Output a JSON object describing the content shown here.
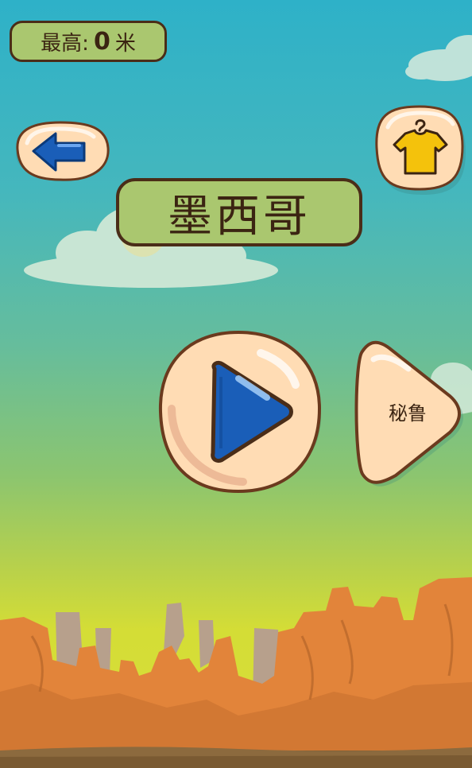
{
  "score": {
    "label": "最高:",
    "value": "0",
    "unit": "米"
  },
  "level": {
    "title": "墨西哥"
  },
  "next_level": {
    "label": "秘鲁"
  },
  "icons": {
    "back": "arrow-left-icon",
    "shop": "shirt-icon",
    "play": "play-icon"
  },
  "colors": {
    "pill_fill": "#aac76f",
    "outline": "#4a2d18",
    "button_fill": "#ffdcb4",
    "play_blue": "#1a5eb8",
    "shirt_yellow": "#f4c20c",
    "rock_orange": "#e2843a"
  }
}
